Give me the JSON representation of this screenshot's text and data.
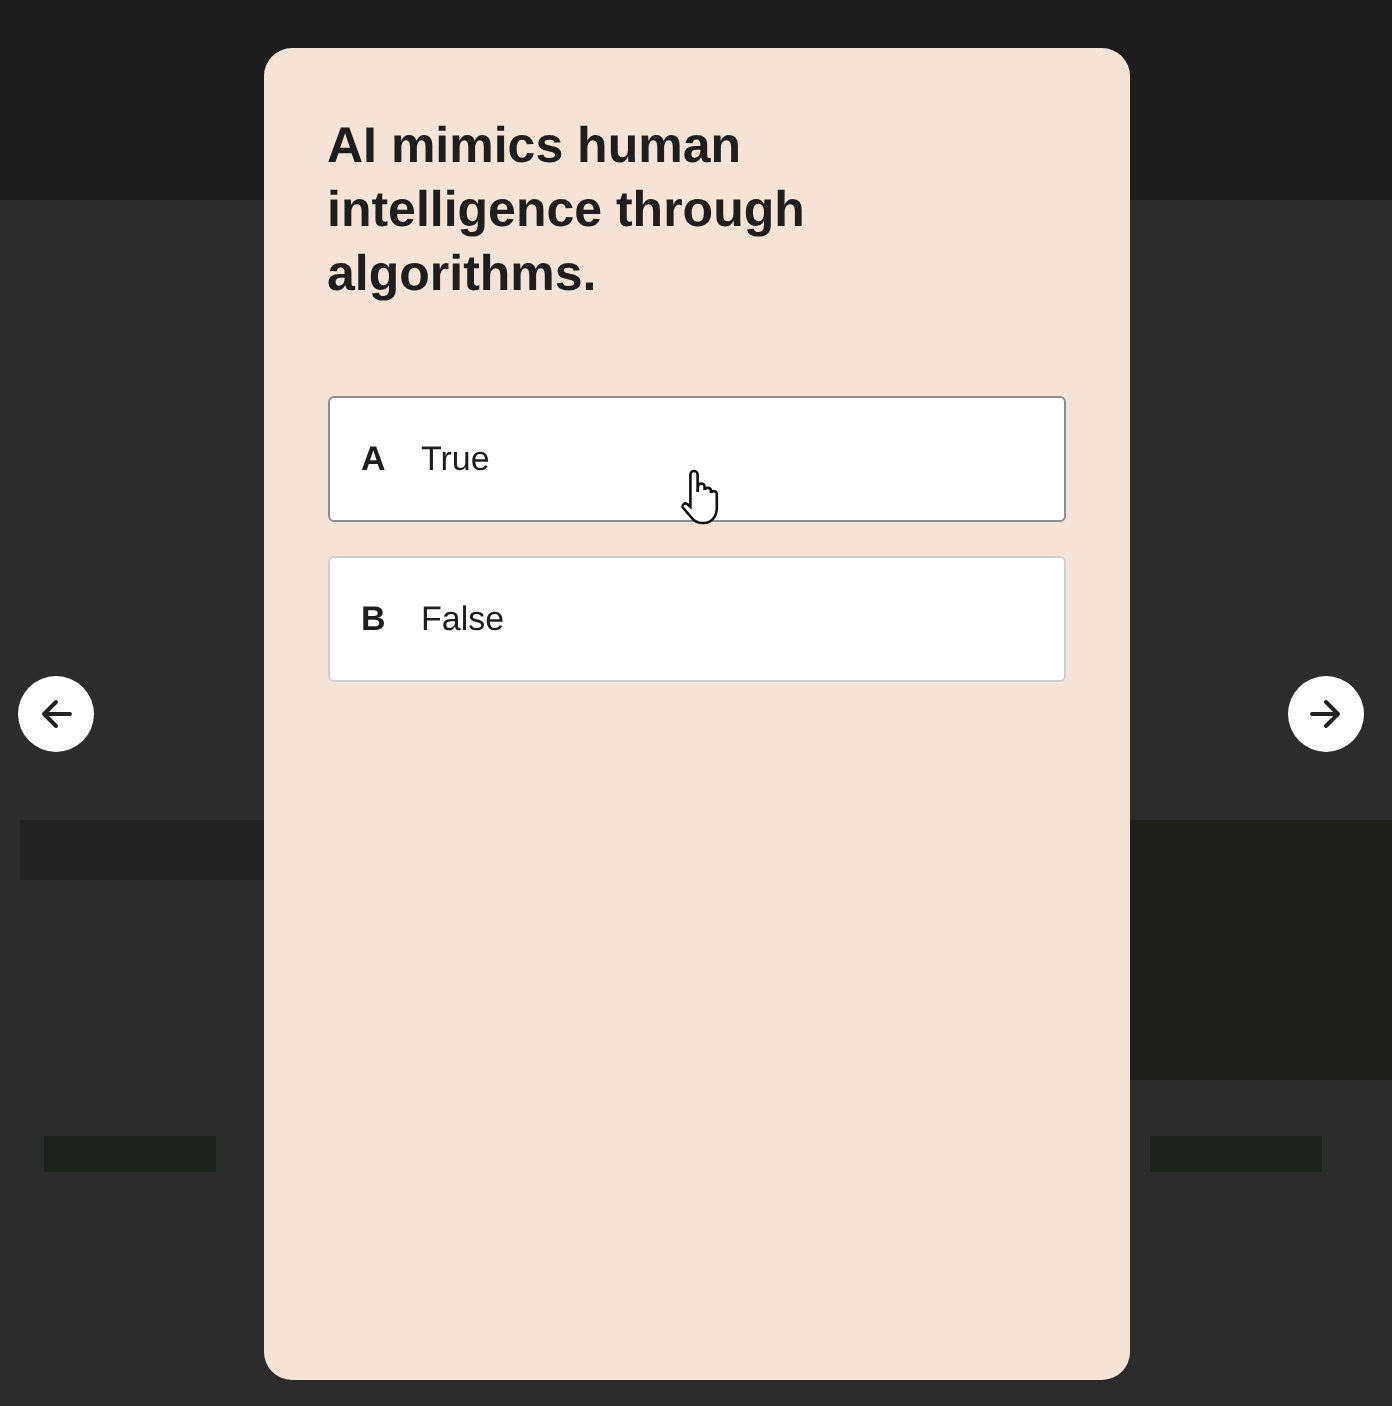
{
  "question": "AI mimics human intelligence through algorithms.",
  "options": [
    {
      "letter": "A",
      "label": "True",
      "hovered": true
    },
    {
      "letter": "B",
      "label": "False",
      "hovered": false
    }
  ],
  "nav": {
    "previous": {
      "disabled": false
    },
    "next": {
      "disabled": false
    }
  }
}
